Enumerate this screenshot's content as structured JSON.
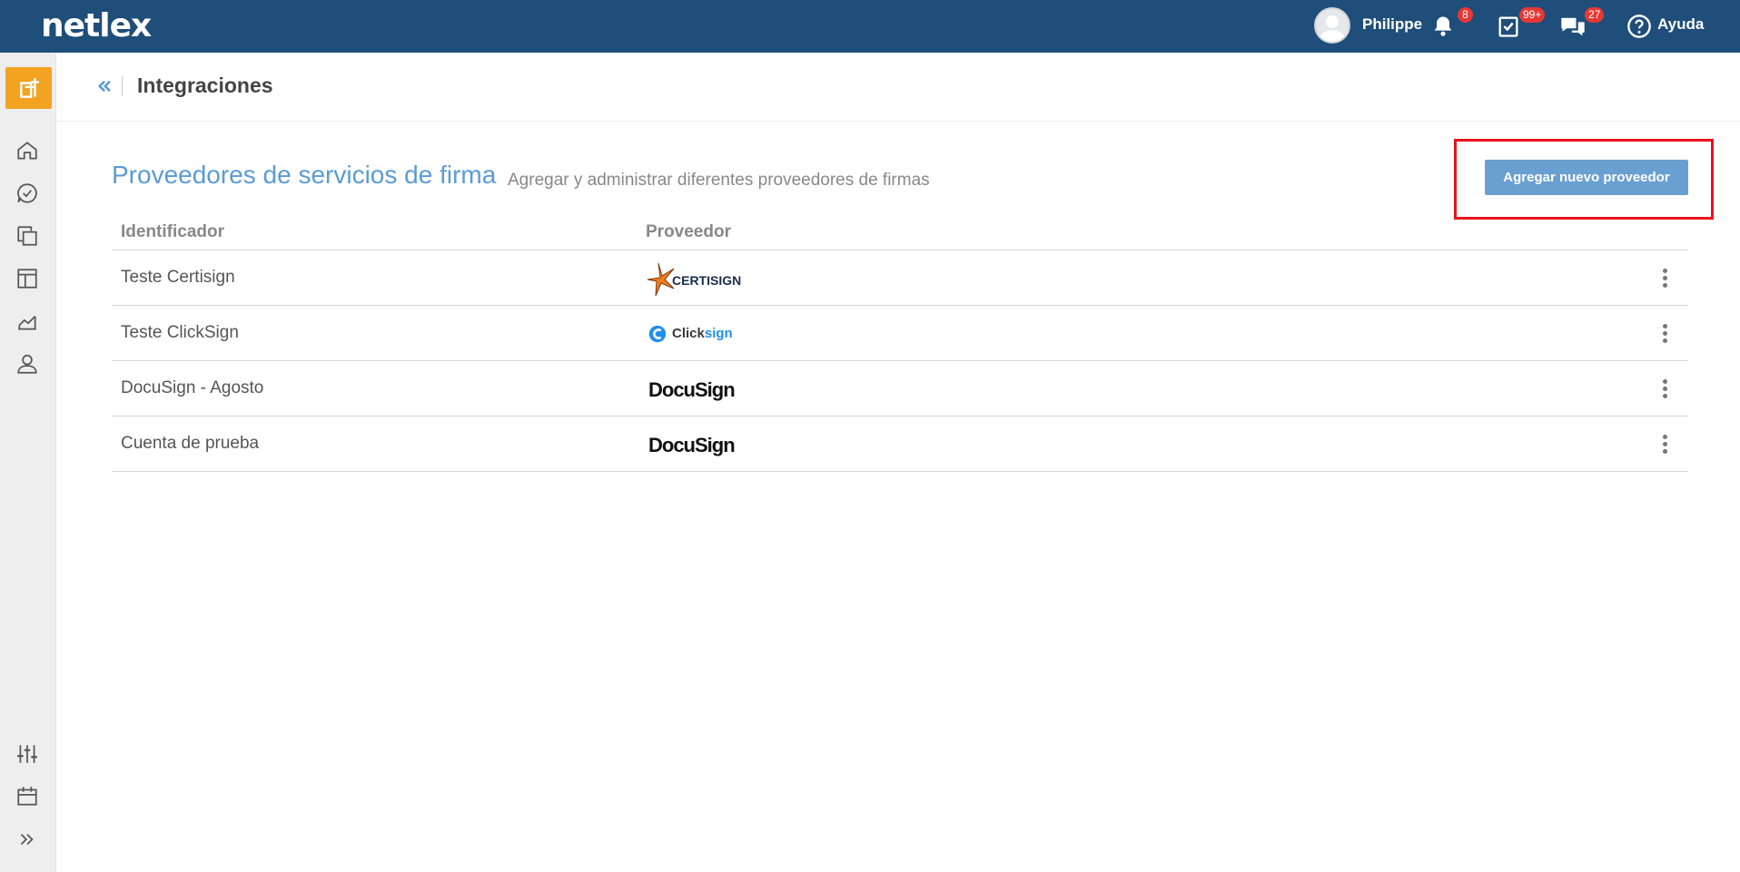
{
  "app": {
    "logo_text": "netlex",
    "user_name": "Philippe",
    "notifications_badge": "8",
    "tasks_badge": "99+",
    "messages_badge": "27",
    "help_label": "Ayuda"
  },
  "sidebar": {
    "items": [
      {
        "name": "home",
        "icon": "home-icon"
      },
      {
        "name": "tasks",
        "icon": "check-bubble-icon"
      },
      {
        "name": "documents",
        "icon": "copy-icon"
      },
      {
        "name": "boards",
        "icon": "layout-icon"
      },
      {
        "name": "reports",
        "icon": "chart-icon"
      },
      {
        "name": "contacts",
        "icon": "user-icon"
      },
      {
        "name": "settings",
        "icon": "sliders-icon"
      },
      {
        "name": "calendar",
        "icon": "calendar-icon"
      },
      {
        "name": "expand",
        "icon": "double-chevron-right-icon"
      }
    ]
  },
  "page": {
    "title": "Integraciones"
  },
  "section": {
    "title": "Proveedores de servicios de firma",
    "subtitle": "Agregar y administrar diferentes proveedores de firmas",
    "add_button": "Agregar nuevo proveedor"
  },
  "table": {
    "headers": {
      "id": "Identificador",
      "provider": "Proveedor"
    },
    "rows": [
      {
        "id": "Teste Certisign",
        "provider_logo": "CERTISIGN"
      },
      {
        "id": "Teste ClickSign",
        "provider_logo": "Clicksign"
      },
      {
        "id": "DocuSign - Agosto",
        "provider_logo": "DocuSign"
      },
      {
        "id": "Cuenta de prueba",
        "provider_logo": "DocuSign"
      }
    ]
  },
  "colors": {
    "topbar": "#1e4e79",
    "accent": "#5b9bd5",
    "button": "#6a9fd1",
    "new_button": "#f3a322",
    "badge": "#e53935",
    "highlight": "#e8111e"
  }
}
